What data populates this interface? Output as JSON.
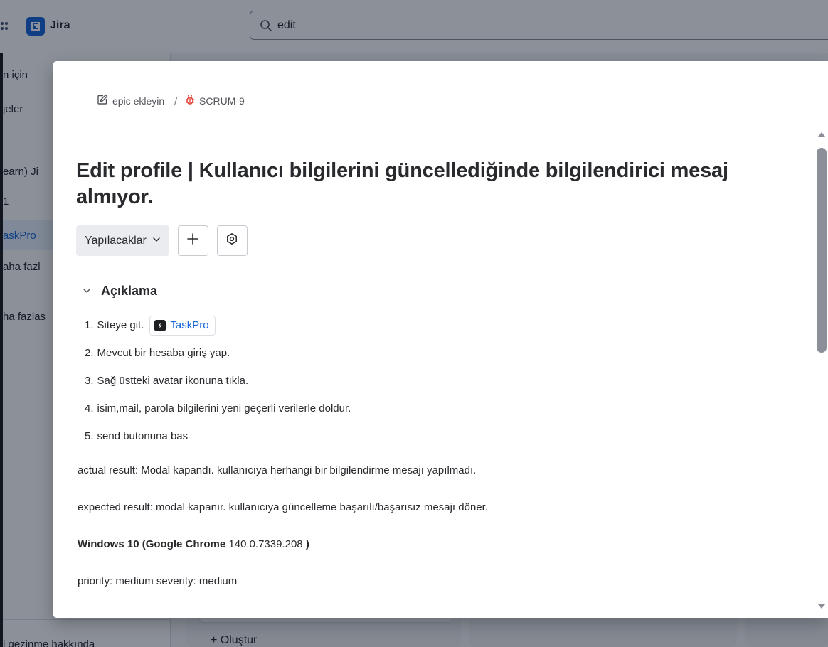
{
  "topbar": {
    "app_name": "Jira",
    "search_value": "edit"
  },
  "sidebar": {
    "items": [
      {
        "label": "n için"
      },
      {
        "label": "jeler"
      },
      {
        "label": "earn) Ji"
      },
      {
        "label": "1"
      },
      {
        "label": "askPro"
      },
      {
        "label": "aha fazl"
      },
      {
        "label": "ha fazlas"
      }
    ],
    "bottom_label": "i gezinme hakkında"
  },
  "board": {
    "create_label": "Oluştur"
  },
  "modal": {
    "breadcrumb": {
      "epic_label": "epic ekleyin",
      "separator": "/",
      "issue_key": "SCRUM-9"
    },
    "title": "Edit profile | Kullanıcı bilgilerini güncellediğinde bilgilendirici mesaj almıyor.",
    "status_label": "Yapılacaklar",
    "description": {
      "heading": "Açıklama",
      "steps": [
        {
          "num": "1.",
          "text": "Siteye git."
        },
        {
          "num": "2.",
          "text": "Mevcut bir hesaba giriş yap."
        },
        {
          "num": "3.",
          "text": "Sağ üstteki avatar ikonuna tıkla."
        },
        {
          "num": "4.",
          "text": "isim,mail, parola bilgilerini yeni geçerli verilerle doldur."
        },
        {
          "num": "5.",
          "text": "send butonuna bas"
        }
      ],
      "link_label": "TaskPro",
      "actual_result": "actual result: Modal kapandı. kullanıcıya herhangi bir bilgilendirme mesajı yapılmadı.",
      "expected_result": "expected result: modal kapanır. kullanıcıya güncelleme başarılı/başarısız mesajı döner.",
      "env_bold": "Windows 10 (Google Chrome",
      "env_version": " 140.0.7339.208",
      "env_close": " )",
      "priority": "priority: medium severity: medium"
    }
  },
  "colors": {
    "brand": "#1868db",
    "bug": "#e2483d",
    "link": "#1868db"
  },
  "icons": [
    "grid-icon",
    "jira-logo-icon",
    "search-icon",
    "edit-icon",
    "bug-icon",
    "chevron-down-icon",
    "plus-icon",
    "settings-icon",
    "link-favicon-icon"
  ]
}
